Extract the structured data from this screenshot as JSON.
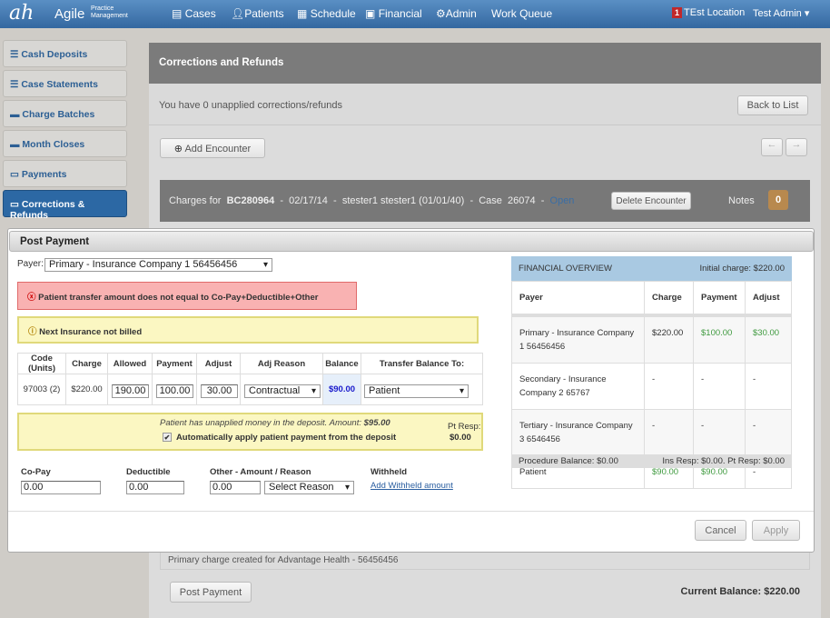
{
  "header": {
    "logo": "ah",
    "brand": "Agile",
    "brand_sub": "Practice Management",
    "nav": [
      "Cases",
      "Patients",
      "Schedule",
      "Financial",
      "Admin",
      "Work Queue"
    ],
    "location_badge": "1",
    "location": "TEst Location",
    "user": "Test Admin"
  },
  "sidebar": {
    "items": [
      {
        "label": "Cash Deposits"
      },
      {
        "label": "Case Statements"
      },
      {
        "label": "Charge Batches"
      },
      {
        "label": "Month Closes"
      },
      {
        "label": "Payments"
      },
      {
        "label": "Corrections & Refunds",
        "active": true
      }
    ]
  },
  "main": {
    "title": "Corrections and Refunds",
    "unapplied_text": "You have 0 unapplied corrections/refunds",
    "back_label": "Back to List",
    "add_encounter_label": "Add Encounter",
    "encounter": {
      "prefix": "Charges for",
      "id": "BC280964",
      "date": "02/17/14",
      "patient": "stester1 stester1 (01/01/40)",
      "case_label": "Case",
      "case": "26074",
      "status": "Open",
      "delete_label": "Delete Encounter",
      "notes_label": "Notes",
      "notes_count": "0"
    },
    "charge_row": {
      "description": "Primary charge created for Advantage Health - 56456456"
    },
    "post_payment_label": "Post Payment",
    "current_balance": "Current Balance: $220.00"
  },
  "modal": {
    "title": "Post Payment",
    "payer_label": "Payer:",
    "payer": "Primary - Insurance Company 1 56456456",
    "error": "Patient transfer amount does not equal to Co-Pay+Deductible+Other",
    "warning": "Next Insurance not billed",
    "table": {
      "headers": [
        "Code (Units)",
        "Charge",
        "Allowed",
        "Payment",
        "Adjust",
        "Adj Reason",
        "Balance",
        "Transfer Balance To:"
      ],
      "row": {
        "code": "97003 (2)",
        "charge": "$220.00",
        "allowed": "190.00",
        "payment": "100.00",
        "adjust": "30.00",
        "adj_reason": "Contractual",
        "balance": "$90.00",
        "transfer_to": "Patient"
      }
    },
    "deposit": {
      "note": "Patient has unapplied money in the deposit. Amount:",
      "amount": "$95.00",
      "auto_apply_label": "Automatically apply patient payment from the deposit",
      "auto_apply_checked": true,
      "pt_resp_label": "Pt Resp:",
      "pt_resp": "$0.00"
    },
    "copay_label": "Co-Pay",
    "copay": "0.00",
    "deductible_label": "Deductible",
    "deductible": "0.00",
    "other_label": "Other - Amount / Reason",
    "other": "0.00",
    "reason": "Select Reason",
    "withheld_label": "Withheld",
    "withheld_link": "Add Withheld amount",
    "cancel_label": "Cancel",
    "apply_label": "Apply",
    "overview": {
      "title": "FINANCIAL OVERVIEW",
      "initial_charge": "Initial charge: $220.00",
      "headers": [
        "Payer",
        "Charge",
        "Payment",
        "Adjust"
      ],
      "rows": [
        [
          "Primary - Insurance Company 1 56456456",
          "$220.00",
          "$100.00",
          "$30.00"
        ],
        [
          "Secondary - Insurance Company 2 65767",
          "-",
          "-",
          "-"
        ],
        [
          "Tertiary - Insurance Company 3 6546456",
          "-",
          "-",
          "-"
        ],
        [
          "Patient",
          "$90.00",
          "$90.00",
          "-"
        ]
      ],
      "procedure_balance": "Procedure Balance: $0.00",
      "resp": "Ins Resp: $0.00. Pt Resp: $0.00"
    }
  }
}
